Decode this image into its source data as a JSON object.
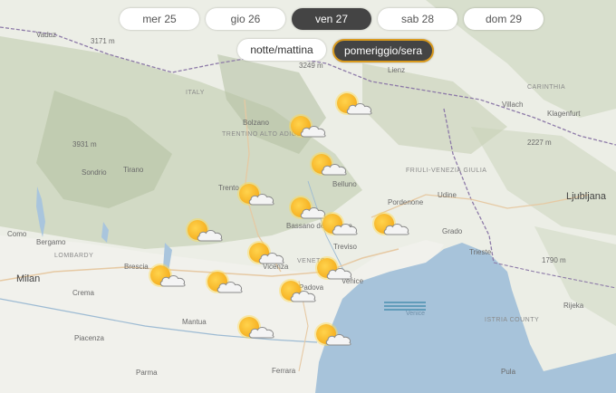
{
  "days": [
    {
      "label": "mer 25",
      "active": false
    },
    {
      "label": "gio 26",
      "active": false
    },
    {
      "label": "ven 27",
      "active": true
    },
    {
      "label": "sab 28",
      "active": false
    },
    {
      "label": "dom 29",
      "active": false
    }
  ],
  "periods": [
    {
      "label": "notte/mattina",
      "active": false
    },
    {
      "label": "pomeriggio/sera",
      "active": true
    }
  ],
  "weather_icon": "sun-behind-cloud-icon",
  "weather_icon_count": 17,
  "place_labels": {
    "vaduz": "Vaduz",
    "italy": "ITALY",
    "lienz": "Lienz",
    "carinthia": "CARINTHIA",
    "villach": "Villach",
    "klagenfurt": "Klagenfurt",
    "bolzano": "Bolzano",
    "trentino": "TRENTINO ALTO ADIGE",
    "sondrio": "Sondrio",
    "tirano": "Tirano",
    "belluno": "Belluno",
    "friuli": "FRIULI-VENEZIA GIULIA",
    "pordenone": "Pordenone",
    "udine": "Udine",
    "ljubljana": "Ljubljana",
    "trento": "Trento",
    "bassano": "Bassano del Grappa",
    "treviso": "Treviso",
    "trieste": "Trieste",
    "como": "Como",
    "bergamo": "Bergamo",
    "lombardy": "LOMBARDY",
    "brescia": "Brescia",
    "veneto": "VENETO",
    "vicenza": "Vicenza",
    "padova": "Padova",
    "venice": "Venice",
    "venice_small": "Venice",
    "milan": "Milan",
    "crema": "Crema",
    "mantua": "Mantua",
    "rijeka": "Rijeka",
    "istria": "ISTRIA COUNTY",
    "piacenza": "Piacenza",
    "parma": "Parma",
    "ferrara": "Ferrara",
    "pula": "Pula",
    "grado": "Grado",
    "elev1": "3931 m",
    "elev2": "2227 m",
    "elev3": "1790 m",
    "elev4": "3171 m",
    "elev5": "3249 m"
  }
}
